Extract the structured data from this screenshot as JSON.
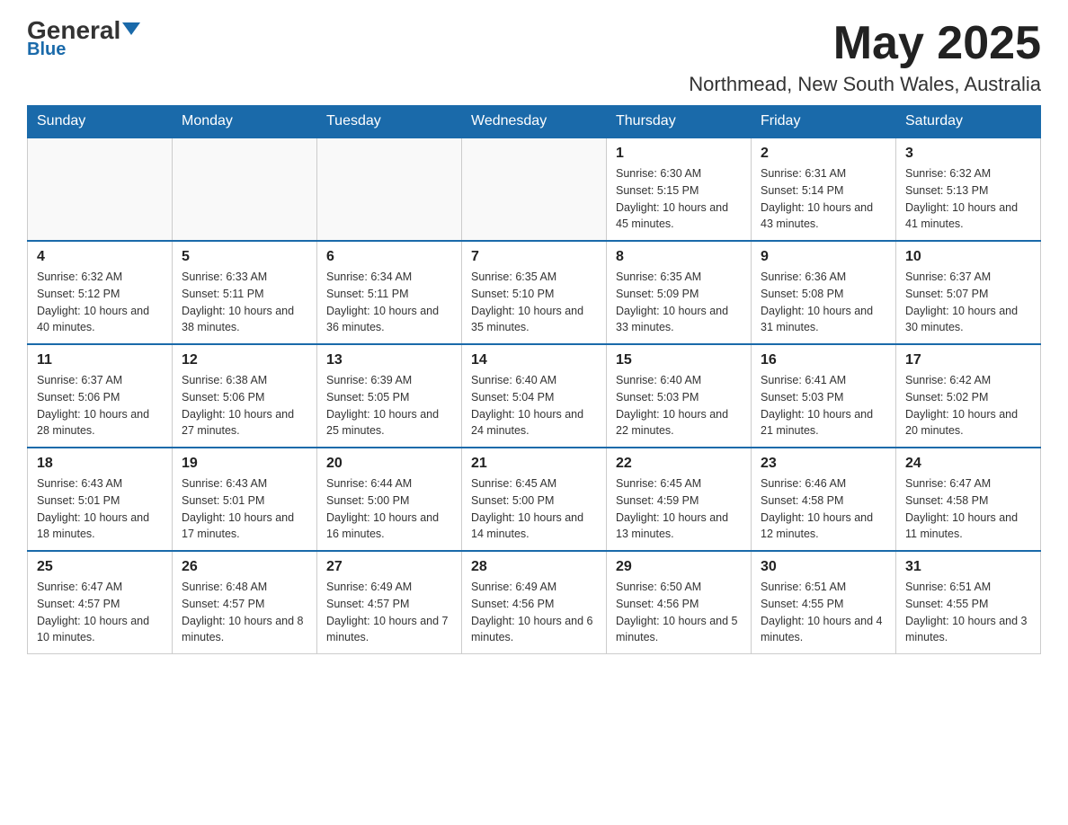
{
  "header": {
    "logo_general": "General",
    "logo_blue": "Blue",
    "month": "May 2025",
    "location": "Northmead, New South Wales, Australia"
  },
  "days_of_week": [
    "Sunday",
    "Monday",
    "Tuesday",
    "Wednesday",
    "Thursday",
    "Friday",
    "Saturday"
  ],
  "weeks": [
    [
      {
        "day": "",
        "info": ""
      },
      {
        "day": "",
        "info": ""
      },
      {
        "day": "",
        "info": ""
      },
      {
        "day": "",
        "info": ""
      },
      {
        "day": "1",
        "info": "Sunrise: 6:30 AM\nSunset: 5:15 PM\nDaylight: 10 hours and 45 minutes."
      },
      {
        "day": "2",
        "info": "Sunrise: 6:31 AM\nSunset: 5:14 PM\nDaylight: 10 hours and 43 minutes."
      },
      {
        "day": "3",
        "info": "Sunrise: 6:32 AM\nSunset: 5:13 PM\nDaylight: 10 hours and 41 minutes."
      }
    ],
    [
      {
        "day": "4",
        "info": "Sunrise: 6:32 AM\nSunset: 5:12 PM\nDaylight: 10 hours and 40 minutes."
      },
      {
        "day": "5",
        "info": "Sunrise: 6:33 AM\nSunset: 5:11 PM\nDaylight: 10 hours and 38 minutes."
      },
      {
        "day": "6",
        "info": "Sunrise: 6:34 AM\nSunset: 5:11 PM\nDaylight: 10 hours and 36 minutes."
      },
      {
        "day": "7",
        "info": "Sunrise: 6:35 AM\nSunset: 5:10 PM\nDaylight: 10 hours and 35 minutes."
      },
      {
        "day": "8",
        "info": "Sunrise: 6:35 AM\nSunset: 5:09 PM\nDaylight: 10 hours and 33 minutes."
      },
      {
        "day": "9",
        "info": "Sunrise: 6:36 AM\nSunset: 5:08 PM\nDaylight: 10 hours and 31 minutes."
      },
      {
        "day": "10",
        "info": "Sunrise: 6:37 AM\nSunset: 5:07 PM\nDaylight: 10 hours and 30 minutes."
      }
    ],
    [
      {
        "day": "11",
        "info": "Sunrise: 6:37 AM\nSunset: 5:06 PM\nDaylight: 10 hours and 28 minutes."
      },
      {
        "day": "12",
        "info": "Sunrise: 6:38 AM\nSunset: 5:06 PM\nDaylight: 10 hours and 27 minutes."
      },
      {
        "day": "13",
        "info": "Sunrise: 6:39 AM\nSunset: 5:05 PM\nDaylight: 10 hours and 25 minutes."
      },
      {
        "day": "14",
        "info": "Sunrise: 6:40 AM\nSunset: 5:04 PM\nDaylight: 10 hours and 24 minutes."
      },
      {
        "day": "15",
        "info": "Sunrise: 6:40 AM\nSunset: 5:03 PM\nDaylight: 10 hours and 22 minutes."
      },
      {
        "day": "16",
        "info": "Sunrise: 6:41 AM\nSunset: 5:03 PM\nDaylight: 10 hours and 21 minutes."
      },
      {
        "day": "17",
        "info": "Sunrise: 6:42 AM\nSunset: 5:02 PM\nDaylight: 10 hours and 20 minutes."
      }
    ],
    [
      {
        "day": "18",
        "info": "Sunrise: 6:43 AM\nSunset: 5:01 PM\nDaylight: 10 hours and 18 minutes."
      },
      {
        "day": "19",
        "info": "Sunrise: 6:43 AM\nSunset: 5:01 PM\nDaylight: 10 hours and 17 minutes."
      },
      {
        "day": "20",
        "info": "Sunrise: 6:44 AM\nSunset: 5:00 PM\nDaylight: 10 hours and 16 minutes."
      },
      {
        "day": "21",
        "info": "Sunrise: 6:45 AM\nSunset: 5:00 PM\nDaylight: 10 hours and 14 minutes."
      },
      {
        "day": "22",
        "info": "Sunrise: 6:45 AM\nSunset: 4:59 PM\nDaylight: 10 hours and 13 minutes."
      },
      {
        "day": "23",
        "info": "Sunrise: 6:46 AM\nSunset: 4:58 PM\nDaylight: 10 hours and 12 minutes."
      },
      {
        "day": "24",
        "info": "Sunrise: 6:47 AM\nSunset: 4:58 PM\nDaylight: 10 hours and 11 minutes."
      }
    ],
    [
      {
        "day": "25",
        "info": "Sunrise: 6:47 AM\nSunset: 4:57 PM\nDaylight: 10 hours and 10 minutes."
      },
      {
        "day": "26",
        "info": "Sunrise: 6:48 AM\nSunset: 4:57 PM\nDaylight: 10 hours and 8 minutes."
      },
      {
        "day": "27",
        "info": "Sunrise: 6:49 AM\nSunset: 4:57 PM\nDaylight: 10 hours and 7 minutes."
      },
      {
        "day": "28",
        "info": "Sunrise: 6:49 AM\nSunset: 4:56 PM\nDaylight: 10 hours and 6 minutes."
      },
      {
        "day": "29",
        "info": "Sunrise: 6:50 AM\nSunset: 4:56 PM\nDaylight: 10 hours and 5 minutes."
      },
      {
        "day": "30",
        "info": "Sunrise: 6:51 AM\nSunset: 4:55 PM\nDaylight: 10 hours and 4 minutes."
      },
      {
        "day": "31",
        "info": "Sunrise: 6:51 AM\nSunset: 4:55 PM\nDaylight: 10 hours and 3 minutes."
      }
    ]
  ]
}
